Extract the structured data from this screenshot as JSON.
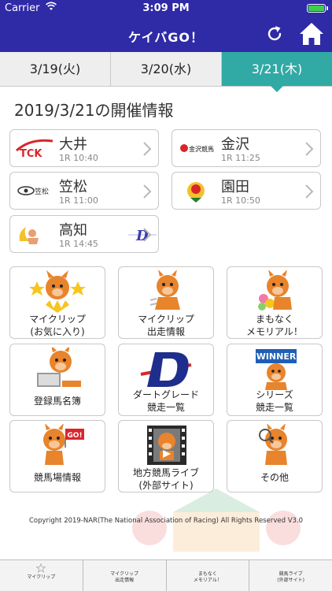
{
  "status": {
    "carrier": "Carrier",
    "time": "3:09 PM"
  },
  "header": {
    "title": "ケイバGO！"
  },
  "tabs": [
    {
      "label": "3/19(火)",
      "active": false
    },
    {
      "label": "3/20(水)",
      "active": false
    },
    {
      "label": "3/21(木)",
      "active": true
    }
  ],
  "page_title": "2019/3/21の開催情報",
  "venues": [
    {
      "name": "大井",
      "race": "1R",
      "time": "10:40",
      "logo_text": "TCK"
    },
    {
      "name": "金沢",
      "race": "1R",
      "time": "11:25",
      "logo_text": "金沢競馬"
    },
    {
      "name": "笠松",
      "race": "1R",
      "time": "11:00",
      "logo_text": "笠松"
    },
    {
      "name": "園田",
      "race": "1R",
      "time": "10:50",
      "logo_text": ""
    },
    {
      "name": "高知",
      "race": "1R",
      "time": "14:45",
      "logo_text": "D"
    }
  ],
  "menu": [
    {
      "line1": "マイクリップ",
      "line2": "(お気に入り)"
    },
    {
      "line1": "マイクリップ",
      "line2": "出走情報"
    },
    {
      "line1": "まもなく",
      "line2": "メモリアル！"
    },
    {
      "line1": "登録馬名簿",
      "line2": ""
    },
    {
      "line1": "ダートグレード",
      "line2": "競走一覧"
    },
    {
      "line1": "シリーズ",
      "line2": "競走一覧",
      "badge": "WINNER"
    },
    {
      "line1": "競馬場情報",
      "line2": "",
      "badge": "GO!"
    },
    {
      "line1": "地方競馬ライブ",
      "line2": "(外部サイト)"
    },
    {
      "line1": "その他",
      "line2": ""
    }
  ],
  "copyright": "Copyright 2019-NAR(The National Association of Racing) All Rights Reserved V3.0",
  "bottom_tabs": [
    {
      "label": "マイクリップ"
    },
    {
      "label": "マイクリップ\n出走情報"
    },
    {
      "label": "まもなく\nメモリアル！"
    },
    {
      "label": "競馬ライブ\n(外部サイト)"
    }
  ],
  "colors": {
    "header": "#2f2aa6",
    "tab_active": "#31a9a4",
    "tab_inactive": "#eeeeee",
    "horse": "#e8842c"
  }
}
